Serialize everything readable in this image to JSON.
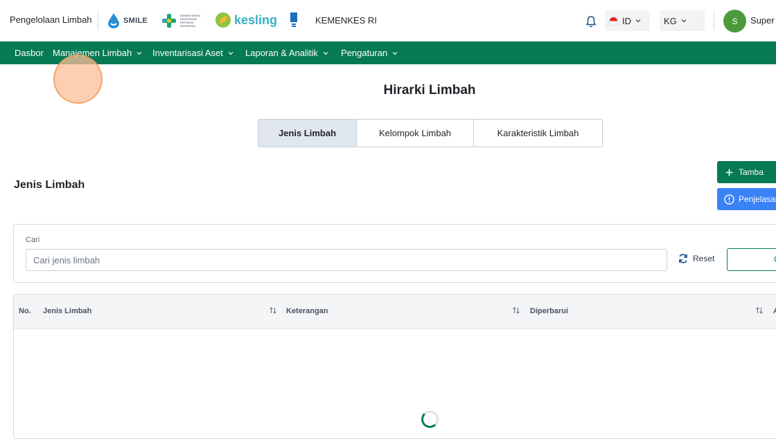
{
  "header": {
    "app_title": "Pengelolaan Limbah",
    "logos": {
      "smile": "SMILE",
      "kemenkes_logo_text": "KEMENTERIAN KESEHATAN REPUBLIK INDONESIA",
      "kesling": "kesling"
    },
    "org_name": "KEMENKES RI",
    "language": "ID",
    "unit": "KG",
    "user_initial": "S",
    "user_name": "Super A"
  },
  "nav": {
    "items": [
      {
        "label": "Dasbor",
        "has_dropdown": false
      },
      {
        "label": "Manajemen Limbah",
        "has_dropdown": true
      },
      {
        "label": "Inventarisasi Aset",
        "has_dropdown": true
      },
      {
        "label": "Laporan & Analitik",
        "has_dropdown": true
      },
      {
        "label": "Pengaturan",
        "has_dropdown": true
      }
    ]
  },
  "page": {
    "title": "Hirarki Limbah",
    "tabs": [
      {
        "label": "Jenis Limbah",
        "active": true
      },
      {
        "label": "Kelompok Limbah",
        "active": false
      },
      {
        "label": "Karakteristik Limbah",
        "active": false
      }
    ],
    "section_title": "Jenis Limbah",
    "add_button_label": "Tamba",
    "info_button_label": "Penjelasan"
  },
  "search": {
    "label": "Cari",
    "placeholder": "Cari jenis limbah",
    "value": "",
    "reset_label": "Reset",
    "search_button_label": "C"
  },
  "table": {
    "columns": [
      {
        "label": "No.",
        "sortable": false
      },
      {
        "label": "Jenis Limbah",
        "sortable": true
      },
      {
        "label": "Keterangan",
        "sortable": true
      },
      {
        "label": "Diperbarui",
        "sortable": true
      },
      {
        "label": "A",
        "sortable": false
      }
    ],
    "rows": [],
    "loading": true
  },
  "colors": {
    "primary": "#067a53",
    "info": "#3b82f6",
    "tab_active_bg": "#e1e7ef"
  }
}
